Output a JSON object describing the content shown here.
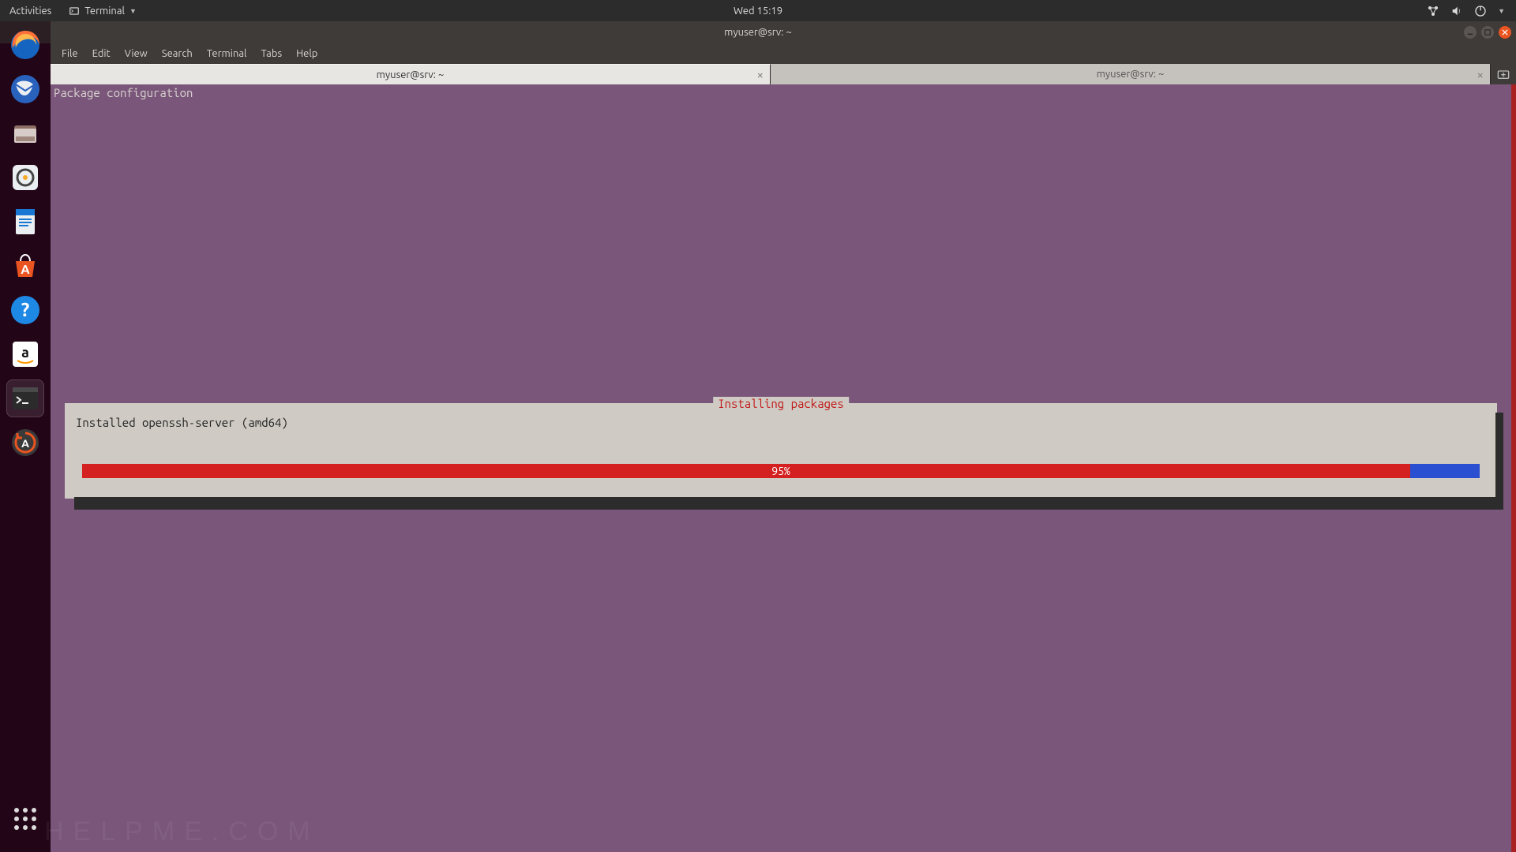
{
  "topbar": {
    "activities": "Activities",
    "app_label": "Terminal",
    "clock": "Wed 15:19"
  },
  "window": {
    "title": "myuser@srv: ~"
  },
  "menubar": [
    "File",
    "Edit",
    "View",
    "Search",
    "Terminal",
    "Tabs",
    "Help"
  ],
  "tabs": [
    {
      "label": "myuser@srv: ~",
      "active": true
    },
    {
      "label": "myuser@srv: ~",
      "active": false
    }
  ],
  "terminal": {
    "header": "Package configuration",
    "dialog_title": "Installing packages",
    "status_line": "Installed openssh-server (amd64)",
    "progress_percent": 95,
    "progress_label": "95%"
  },
  "dock_items": [
    "firefox",
    "thunderbird",
    "files",
    "rhythmbox",
    "writer",
    "software",
    "help",
    "amazon",
    "terminal",
    "updater"
  ],
  "watermark": "HELPME.COM"
}
